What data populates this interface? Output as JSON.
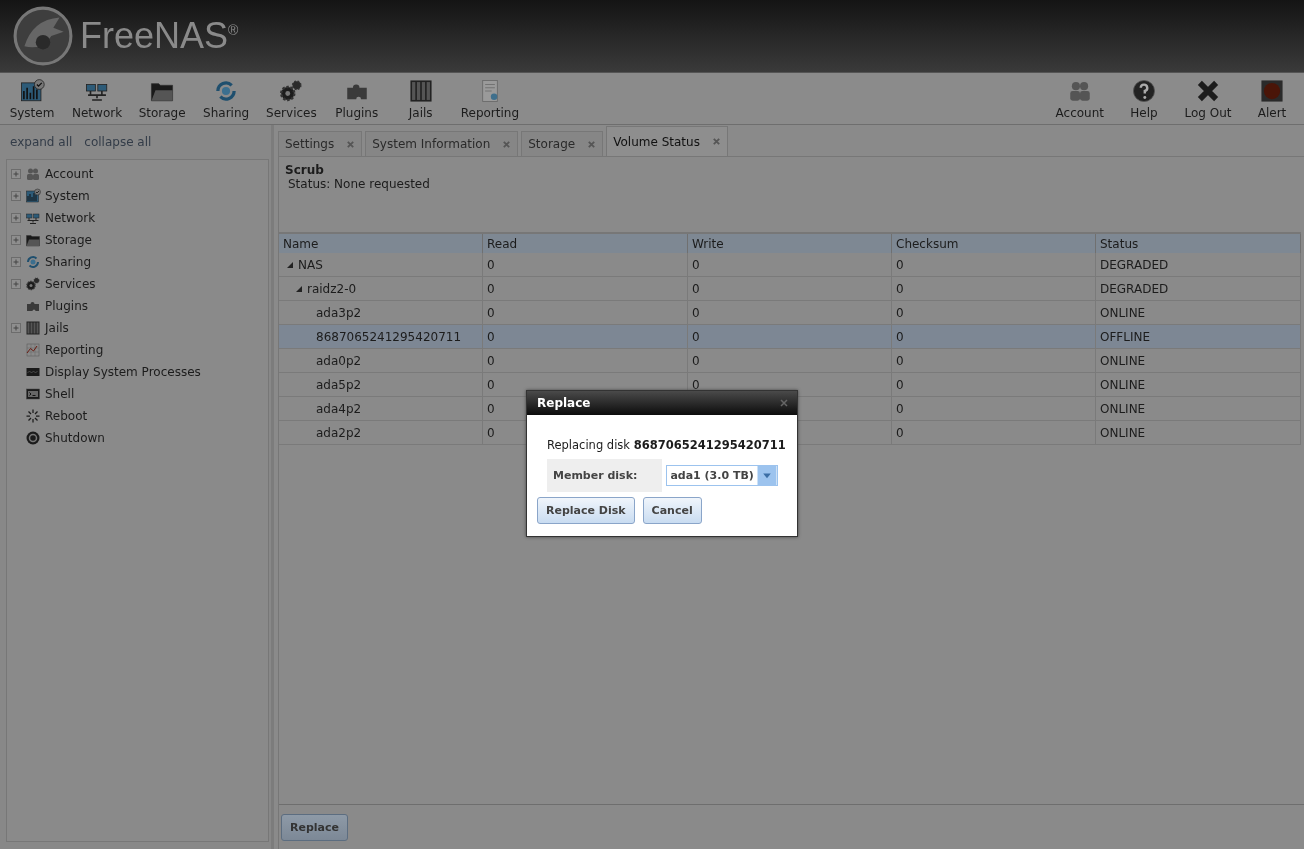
{
  "logo": {
    "text": "FreeNAS$^{®}$"
  },
  "toolbar": {
    "left": [
      {
        "label": "System"
      },
      {
        "label": "Network"
      },
      {
        "label": "Storage"
      },
      {
        "label": "Sharing"
      },
      {
        "label": "Services"
      },
      {
        "label": "Plugins"
      },
      {
        "label": "Jails"
      },
      {
        "label": "Reporting"
      }
    ],
    "right": [
      {
        "label": "Account"
      },
      {
        "label": "Help"
      },
      {
        "label": "Log Out"
      },
      {
        "label": "Alert"
      }
    ]
  },
  "sidebar": {
    "links": [
      "expand all",
      "collapse all"
    ],
    "items": [
      {
        "label": "Account",
        "has_children": true
      },
      {
        "label": "System",
        "has_children": true
      },
      {
        "label": "Network",
        "has_children": true
      },
      {
        "label": "Storage",
        "has_children": true
      },
      {
        "label": "Sharing",
        "has_children": true
      },
      {
        "label": "Services",
        "has_children": true
      },
      {
        "label": "Plugins",
        "has_children": false
      },
      {
        "label": "Jails",
        "has_children": true
      },
      {
        "label": "Reporting",
        "has_children": false
      },
      {
        "label": "Display System Processes",
        "has_children": false
      },
      {
        "label": "Shell",
        "has_children": false
      },
      {
        "label": "Reboot",
        "has_children": false
      },
      {
        "label": "Shutdown",
        "has_children": false
      }
    ]
  },
  "tabs": [
    {
      "label": "Settings",
      "selected": false
    },
    {
      "label": "System Information",
      "selected": false
    },
    {
      "label": "Storage",
      "selected": false
    },
    {
      "label": "Volume Status",
      "selected": true
    }
  ],
  "scrub": {
    "title": "Scrub",
    "status": "Status: None requested"
  },
  "table": {
    "columns": [
      "Name",
      "Read",
      "Write",
      "Checksum",
      "Status"
    ],
    "rows": [
      {
        "name": "NAS",
        "read": "0",
        "write": "0",
        "checksum": "0",
        "status": "DEGRADED",
        "selected": false,
        "expanded": true,
        "children": [
          {
            "name": "raidz2-0",
            "read": "0",
            "write": "0",
            "checksum": "0",
            "status": "DEGRADED",
            "selected": false,
            "expanded": true,
            "children": [
              {
                "name": "ada3p2",
                "read": "0",
                "write": "0",
                "checksum": "0",
                "status": "ONLINE",
                "selected": false
              },
              {
                "name": "8687065241295420711",
                "read": "0",
                "write": "0",
                "checksum": "0",
                "status": "OFFLINE",
                "selected": true
              },
              {
                "name": "ada0p2",
                "read": "0",
                "write": "0",
                "checksum": "0",
                "status": "ONLINE",
                "selected": false
              },
              {
                "name": "ada5p2",
                "read": "0",
                "write": "0",
                "checksum": "0",
                "status": "ONLINE",
                "selected": false
              },
              {
                "name": "ada4p2",
                "read": "0",
                "checksum": "0",
                "status": "ONLINE",
                "selected": false
              },
              {
                "name": "ada2p2",
                "read": "0",
                "checksum": "0",
                "status": "ONLINE",
                "selected": false
              }
            ]
          }
        ]
      }
    ]
  },
  "footer_button": "Replace",
  "dialog": {
    "title": "Replace",
    "message": "Replacing disk **8687065241295420711**",
    "field_label": "Member disk:",
    "select_value": "ada1 (3.0 TB)",
    "buttons": [
      "Replace Disk",
      "Cancel"
    ]
  }
}
